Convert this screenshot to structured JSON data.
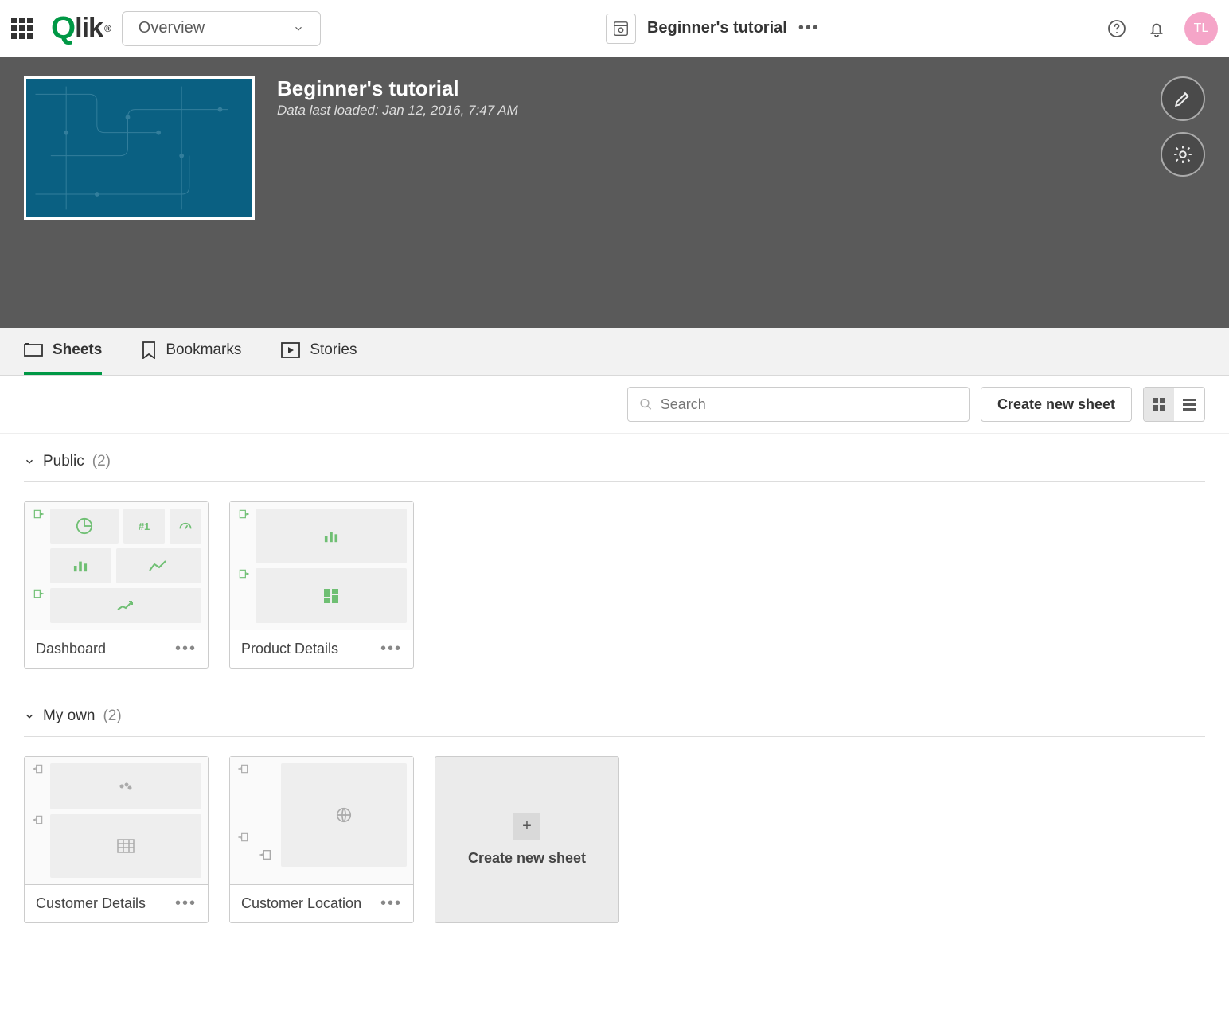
{
  "topbar": {
    "overview_label": "Overview",
    "app_name": "Beginner's tutorial",
    "avatar_initials": "TL"
  },
  "hero": {
    "title": "Beginner's tutorial",
    "subtitle": "Data last loaded: Jan 12, 2016, 7:47 AM"
  },
  "tabs": {
    "sheets": "Sheets",
    "bookmarks": "Bookmarks",
    "stories": "Stories"
  },
  "toolbar": {
    "search_placeholder": "Search",
    "create_label": "Create new sheet"
  },
  "sections": {
    "public": {
      "label": "Public",
      "count": "(2)"
    },
    "myown": {
      "label": "My own",
      "count": "(2)"
    }
  },
  "sheets": {
    "dashboard": "Dashboard",
    "product_details": "Product Details",
    "customer_details": "Customer Details",
    "customer_location": "Customer Location",
    "hash_one": "#1"
  },
  "new_sheet_label": "Create new sheet"
}
